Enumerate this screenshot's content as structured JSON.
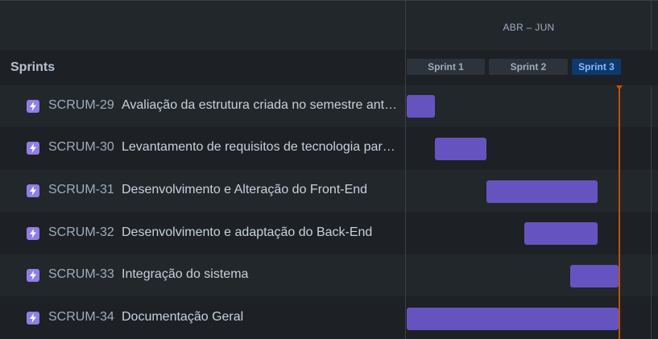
{
  "timeline": {
    "period_label": "ABR – JUN"
  },
  "sprints_header": {
    "title": "Sprints"
  },
  "sprints": [
    {
      "label": "Sprint 1",
      "active": false
    },
    {
      "label": "Sprint 2",
      "active": false
    },
    {
      "label": "Sprint 3",
      "active": true
    }
  ],
  "issues": [
    {
      "key": "SCRUM-29",
      "summary": "Avaliação da estrutura criada no semestre anterior",
      "type_icon": "epic-lightning-icon"
    },
    {
      "key": "SCRUM-30",
      "summary": "Levantamento de requisitos de tecnologia para o projeto",
      "type_icon": "epic-lightning-icon"
    },
    {
      "key": "SCRUM-31",
      "summary": "Desenvolvimento e Alteração do Front-End",
      "type_icon": "epic-lightning-icon"
    },
    {
      "key": "SCRUM-32",
      "summary": "Desenvolvimento e adaptação do Back-End",
      "type_icon": "epic-lightning-icon"
    },
    {
      "key": "SCRUM-33",
      "summary": "Integração do sistema",
      "type_icon": "epic-lightning-icon"
    },
    {
      "key": "SCRUM-34",
      "summary": "Documentação Geral",
      "type_icon": "epic-lightning-icon"
    }
  ],
  "colors": {
    "bar": "#6554c0",
    "today_line": "#c25100",
    "epic_icon": "#8f7ee7",
    "active_sprint_bg": "#0c3a6e"
  }
}
